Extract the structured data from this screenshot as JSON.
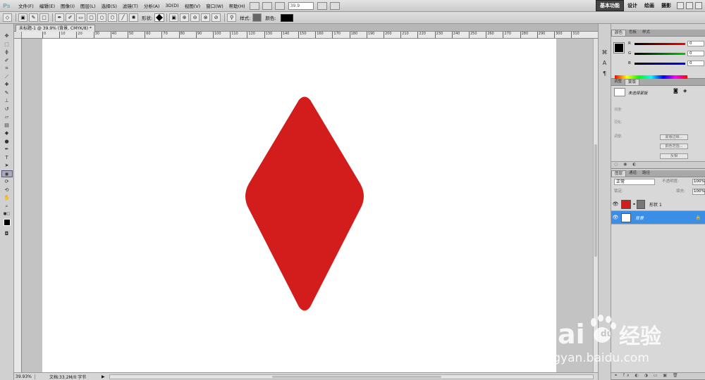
{
  "app": {
    "logo": "Ps"
  },
  "menu": [
    "文件(F)",
    "编辑(E)",
    "图像(I)",
    "图层(L)",
    "选择(S)",
    "滤镜(T)",
    "分析(A)",
    "3D(D)",
    "视图(V)",
    "窗口(W)",
    "帮助(H)"
  ],
  "zoom_field": "39.9",
  "workspaces": [
    "基本功能",
    "设计",
    "绘画",
    "摄影"
  ],
  "options": {
    "shape_label": "形状:",
    "style_label": "样式:",
    "color_label": "颜色:",
    "shape_color": "#000000"
  },
  "document": {
    "tab_title": "未标题-1 @ 39.9% (背景, CMYK/8) *",
    "diamond_color": "#d31d1d",
    "canvas_color": "#ffffff"
  },
  "ruler": {
    "h_ticks": [
      "0",
      "10",
      "20",
      "30",
      "40",
      "50",
      "60",
      "70",
      "80",
      "90",
      "100",
      "110",
      "120",
      "130",
      "140",
      "150",
      "160",
      "170",
      "180",
      "190",
      "200",
      "210",
      "220",
      "230",
      "240",
      "250",
      "260",
      "270",
      "280",
      "290",
      "300",
      "310"
    ]
  },
  "status": {
    "zoom": "39.93%",
    "doc_info": "文档:33.2M/0 字节"
  },
  "color_panel": {
    "tabs": [
      "颜色",
      "色板",
      "样式"
    ],
    "rows": [
      {
        "label": "R",
        "value": "0"
      },
      {
        "label": "G",
        "value": "0"
      },
      {
        "label": "B",
        "value": "0"
      }
    ]
  },
  "adjust_panel": {
    "tabs": [
      "调整",
      "蒙版"
    ],
    "mask_label": "未选择蒙版",
    "dim_labels": [
      "浓度:",
      "羽化:",
      "调整:"
    ],
    "buttons": [
      "蒙版边缘...",
      "颜色范围...",
      "反相"
    ]
  },
  "layers_panel": {
    "tabs": [
      "图层",
      "通道",
      "路径"
    ],
    "blend_mode": "正常",
    "opacity_label": "不透明度:",
    "opacity_value": "100%",
    "lock_label": "锁定:",
    "fill_label": "填充:",
    "fill_value": "100%",
    "layers": [
      {
        "name": "形状 1",
        "thumb_color": "#d31d1d",
        "selected": false
      },
      {
        "name": "背景",
        "thumb_color": "#ffffff",
        "selected": true
      }
    ]
  },
  "watermark": {
    "brand": "Bai",
    "brand2": "du",
    "cn": "经验",
    "url": "jingyan.baidu.com"
  }
}
